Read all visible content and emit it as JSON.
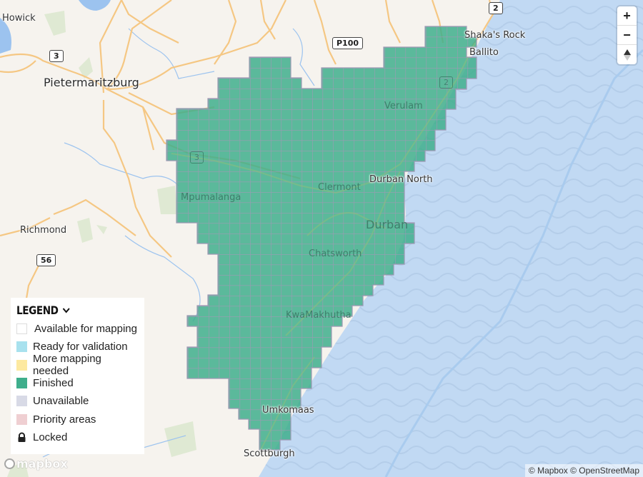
{
  "map": {
    "colors": {
      "land": "#f6f3ee",
      "water": "#c1d9f3",
      "finished": "#3fae8c",
      "grid_line": "#9c99b3",
      "road": "#f5c783",
      "park": "#dfe9d3",
      "river": "#9cc3ef"
    },
    "places": [
      {
        "id": "howick",
        "name": "Howick"
      },
      {
        "id": "pietermaritzburg",
        "name": "Pietermaritzburg"
      },
      {
        "id": "richmond",
        "name": "Richmond"
      },
      {
        "id": "mpumalanga",
        "name": "Mpumalanga"
      },
      {
        "id": "clermont",
        "name": "Clermont"
      },
      {
        "id": "durban",
        "name": "Durban"
      },
      {
        "id": "durban-north",
        "name": "Durban North"
      },
      {
        "id": "chatsworth",
        "name": "Chatsworth"
      },
      {
        "id": "verulam",
        "name": "Verulam"
      },
      {
        "id": "kwamakhutha",
        "name": "KwaMakhutha"
      },
      {
        "id": "umkomaas",
        "name": "Umkomaas"
      },
      {
        "id": "scottburgh",
        "name": "Scottburgh"
      },
      {
        "id": "shakas-rock",
        "name": "Shaka's Rock"
      },
      {
        "id": "ballito",
        "name": "Ballito"
      }
    ],
    "shields": [
      {
        "id": "r3-north",
        "label": "3"
      },
      {
        "id": "p100",
        "label": "P100"
      },
      {
        "id": "n2-north",
        "label": "2"
      },
      {
        "id": "r56",
        "label": "56"
      },
      {
        "id": "r3-under",
        "label": "3"
      },
      {
        "id": "n2-under",
        "label": "2"
      }
    ]
  },
  "zoom_controls": {
    "zoom_in": "+",
    "zoom_out": "−",
    "compass": "▲"
  },
  "legend": {
    "title": "LEGEND",
    "toggle_icon": "chevron-down",
    "items": [
      {
        "label": "Available for mapping",
        "color": "#ffffff",
        "kind": "hollow"
      },
      {
        "label": "Ready for validation",
        "color": "#a8e1ee",
        "kind": "swatch"
      },
      {
        "label": "More mapping needed",
        "color": "#fde9a0",
        "kind": "swatch"
      },
      {
        "label": "Finished",
        "color": "#3fae8c",
        "kind": "swatch"
      },
      {
        "label": "Unavailable",
        "color": "#d8dae6",
        "kind": "swatch"
      },
      {
        "label": "Priority areas",
        "color": "#efcfd2",
        "kind": "swatch"
      },
      {
        "label": "Locked",
        "color": "#222222",
        "kind": "lock-icon"
      }
    ]
  },
  "logo": {
    "text": "mapbox"
  },
  "attribution": {
    "text": "© Mapbox © OpenStreetMap"
  }
}
